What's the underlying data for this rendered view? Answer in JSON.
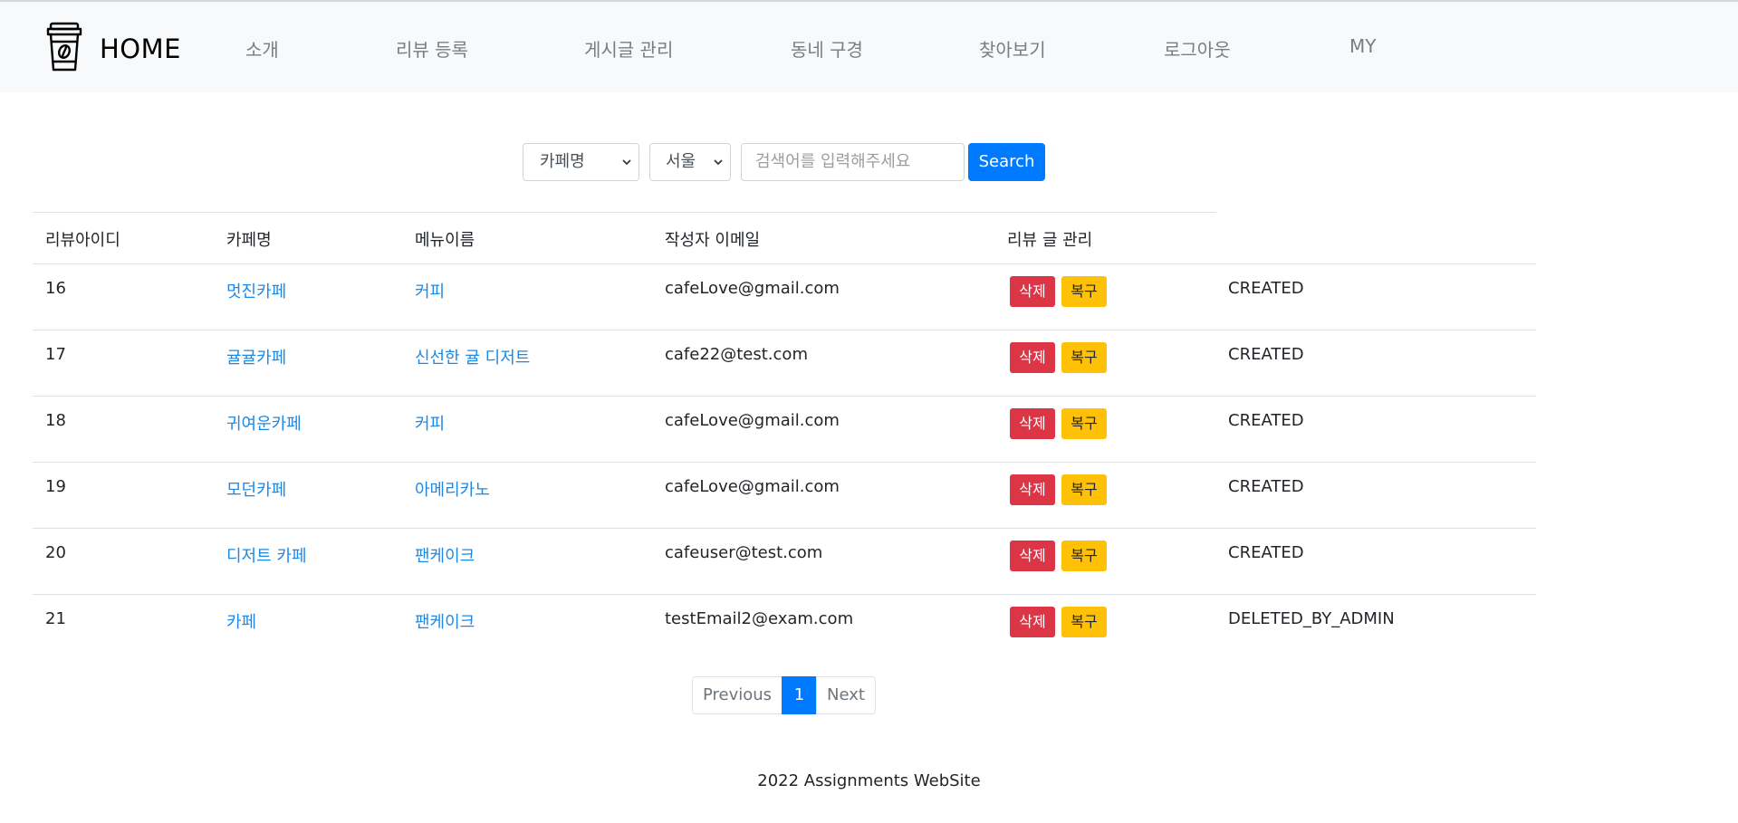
{
  "navbar": {
    "brand": "HOME",
    "links": [
      "소개",
      "리뷰 등록",
      "게시글 관리",
      "동네 구경",
      "찾아보기",
      "로그아웃",
      "MY"
    ]
  },
  "search": {
    "category_value": "카페명",
    "region_value": "서울",
    "placeholder": "검색어를 입력해주세요",
    "button_label": "Search"
  },
  "table": {
    "headers": [
      "리뷰아이디",
      "카페명",
      "메뉴이름",
      "작성자 이메일",
      "리뷰 글 관리"
    ],
    "delete_label": "삭제",
    "restore_label": "복구",
    "rows": [
      {
        "id": "16",
        "cafe": "멋진카페",
        "menu": "커피",
        "email": "cafeLove@gmail.com",
        "status": "CREATED"
      },
      {
        "id": "17",
        "cafe": "귤귤카페",
        "menu": "신선한 귤 디저트",
        "email": "cafe22@test.com",
        "status": "CREATED"
      },
      {
        "id": "18",
        "cafe": "귀여운카페",
        "menu": "커피",
        "email": "cafeLove@gmail.com",
        "status": "CREATED"
      },
      {
        "id": "19",
        "cafe": "모던카페",
        "menu": "아메리카노",
        "email": "cafeLove@gmail.com",
        "status": "CREATED"
      },
      {
        "id": "20",
        "cafe": "디저트 카페",
        "menu": "팬케이크",
        "email": "cafeuser@test.com",
        "status": "CREATED"
      },
      {
        "id": "21",
        "cafe": "카페",
        "menu": "팬케이크",
        "email": "testEmail2@exam.com",
        "status": "DELETED_BY_ADMIN"
      }
    ]
  },
  "pagination": {
    "previous": "Previous",
    "current": "1",
    "next": "Next"
  },
  "footer": {
    "text": "2022 Assignments WebSite"
  },
  "colors": {
    "primary": "#007bff",
    "danger": "#dc3545",
    "warning": "#ffc107",
    "link": "#1e88e5"
  }
}
